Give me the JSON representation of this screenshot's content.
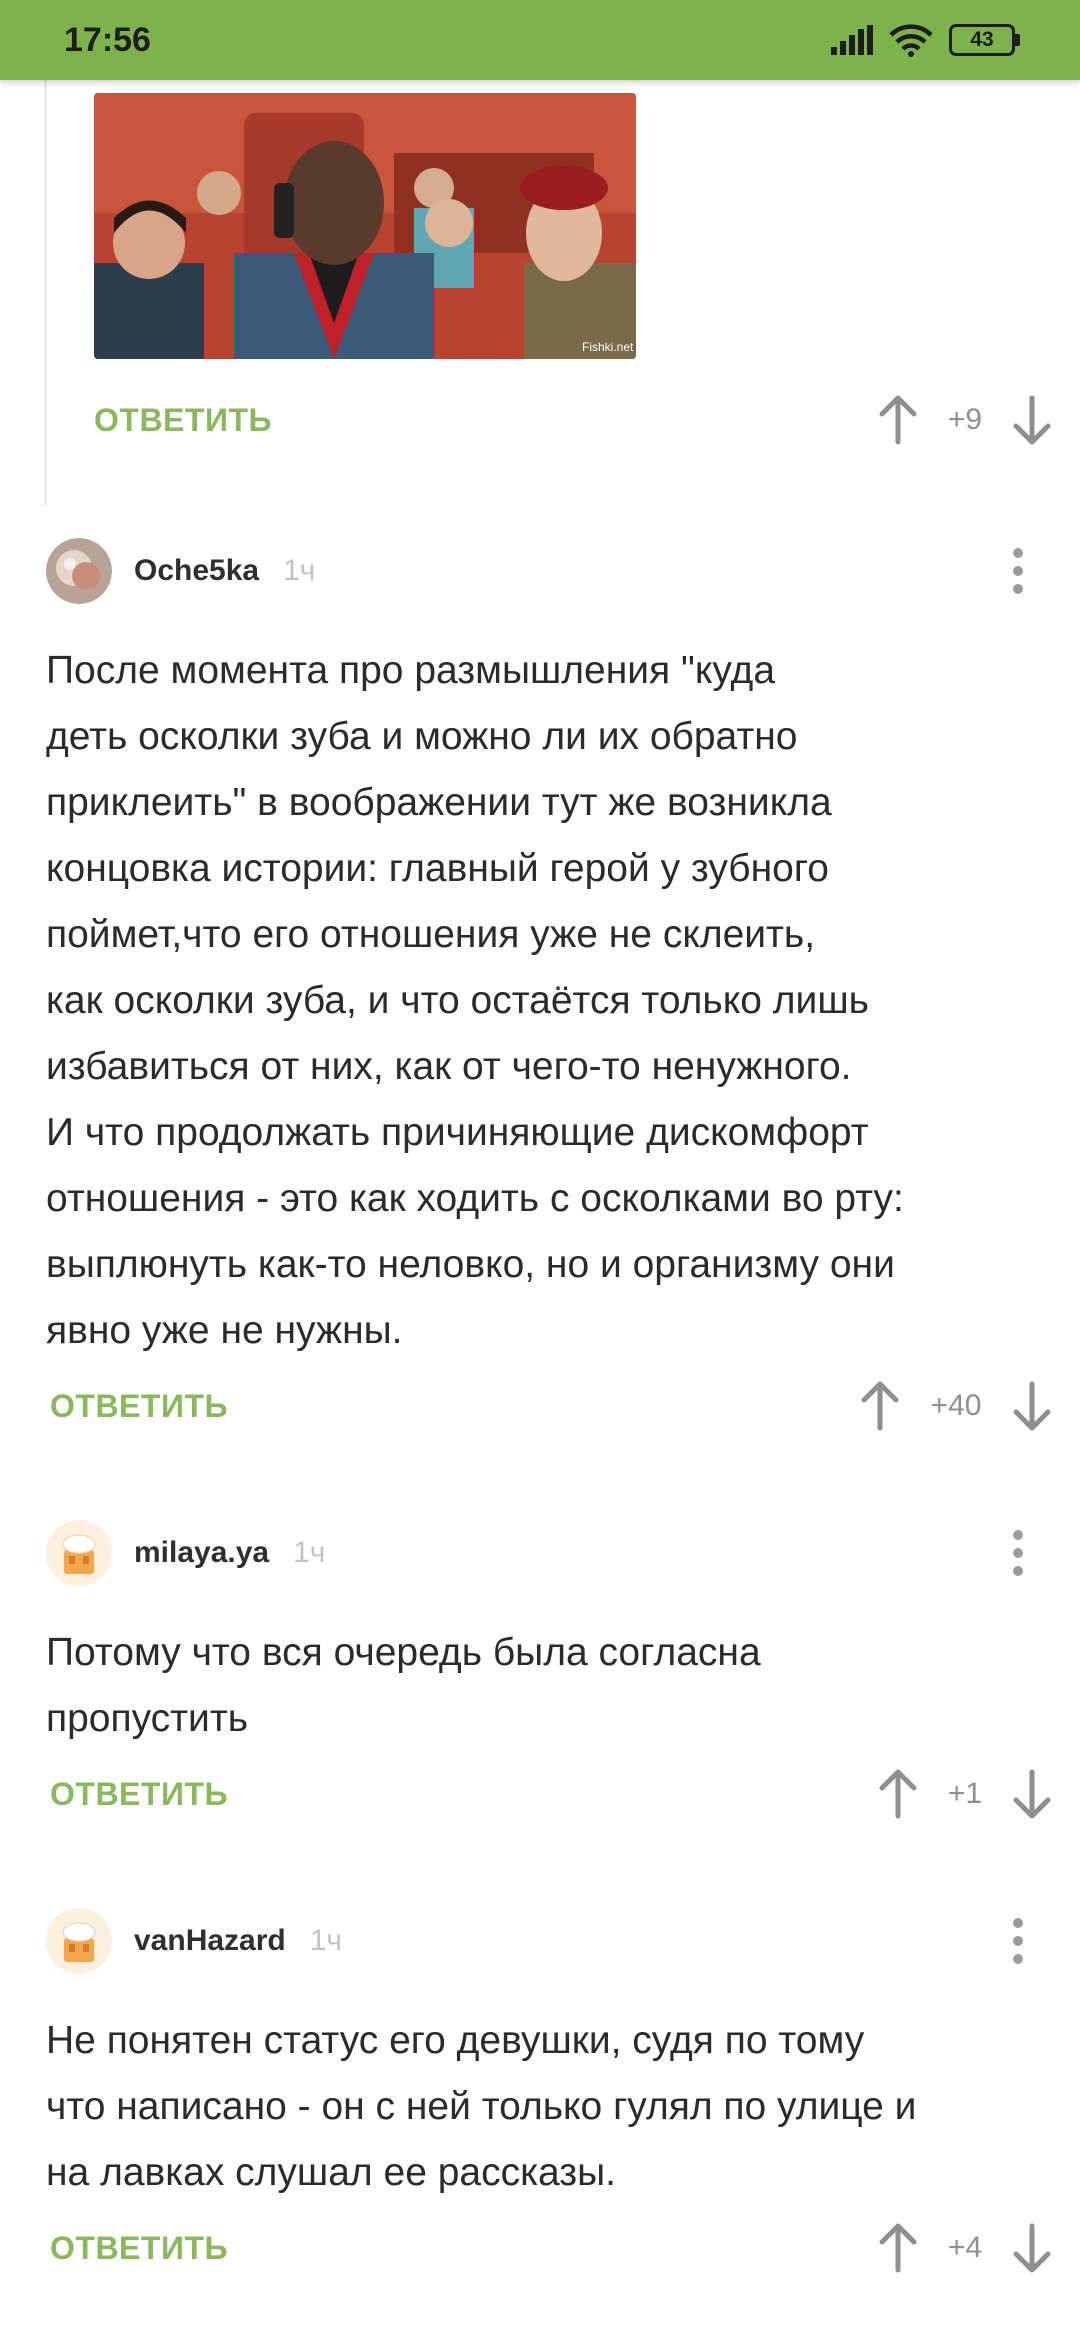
{
  "status_bar": {
    "time": "17:56",
    "battery": "43",
    "icons": [
      "signal-icon",
      "wifi-icon",
      "battery-icon"
    ]
  },
  "colors": {
    "brand_green": "#7db34a",
    "reply_green": "#8ab85d",
    "score_gray": "#8f8f8f"
  },
  "nested_comment": {
    "image_watermark": "Fishki.net",
    "reply_label": "ОТВЕТИТЬ",
    "score": "+9"
  },
  "comments": [
    {
      "username": "Oche5ka",
      "time": "1ч",
      "lines": [
        "После момента про размышления \"куда",
        "деть осколки зуба и можно ли их обратно",
        "приклеить\" в воображении тут же возникла",
        "концовка истории: главный герой у зубного",
        "поймет,что его отношения уже не склеить,",
        "как осколки зуба, и что остаётся только лишь",
        "избавиться от них, как от чего-то ненужного.",
        "И что продолжать причиняющие дискомфорт",
        "отношения - это как ходить с осколками во рту:",
        "выплюнуть как-то неловко, но и организму они",
        "явно уже не нужны."
      ],
      "reply_label": "ОТВЕТИТЬ",
      "score": "+40"
    },
    {
      "username": "milaya.ya",
      "time": "1ч",
      "lines": [
        "Потому что вся очередь была согласна",
        "пропустить"
      ],
      "reply_label": "ОТВЕТИТЬ",
      "score": "+1"
    },
    {
      "username": "vanHazard",
      "time": "1ч",
      "lines": [
        "Не понятен статус его девушки, судя по тому",
        "что написано - он с ней только гулял по улице и",
        "на лавках слушал ее рассказы."
      ],
      "reply_label": "ОТВЕТИТЬ",
      "score": "+4"
    }
  ]
}
